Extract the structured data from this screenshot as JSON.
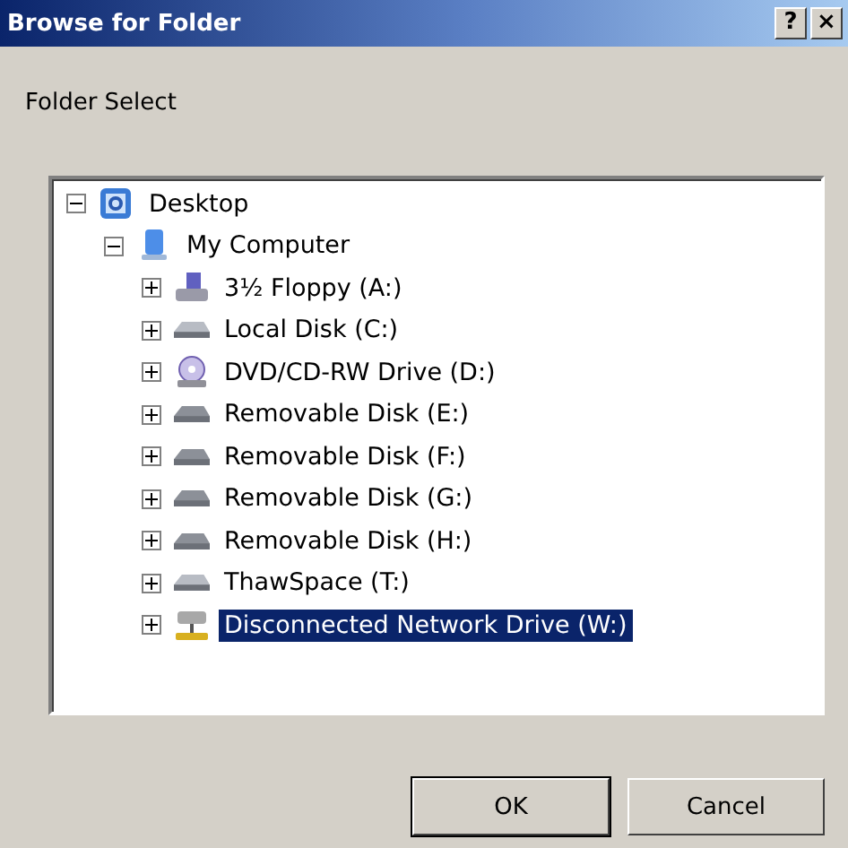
{
  "window": {
    "title": "Browse for Folder",
    "buttons": [
      "?",
      "×"
    ]
  },
  "prompt": "Folder Select",
  "tree": [
    {
      "label": "Desktop",
      "kind": "desktop",
      "expanded": true,
      "selected": false,
      "children": [
        {
          "label": "My Computer",
          "kind": "computer",
          "expanded": true,
          "selected": false,
          "children": [
            {
              "label": "3½ Floppy (A:)",
              "kind": "floppy",
              "expanded": false,
              "selected": false
            },
            {
              "label": "Local Disk (C:)",
              "kind": "disk",
              "expanded": false,
              "selected": false
            },
            {
              "label": "DVD/CD-RW Drive (D:)",
              "kind": "cd",
              "expanded": false,
              "selected": false
            },
            {
              "label": "Removable Disk (E:)",
              "kind": "removable",
              "expanded": false,
              "selected": false
            },
            {
              "label": "Removable Disk (F:)",
              "kind": "removable",
              "expanded": false,
              "selected": false
            },
            {
              "label": "Removable Disk (G:)",
              "kind": "removable",
              "expanded": false,
              "selected": false
            },
            {
              "label": "Removable Disk (H:)",
              "kind": "removable",
              "expanded": false,
              "selected": false
            },
            {
              "label": "ThawSpace (T:)",
              "kind": "disk",
              "expanded": false,
              "selected": false
            },
            {
              "label": "Disconnected Network Drive (W:)",
              "kind": "network",
              "expanded": false,
              "selected": true
            }
          ]
        }
      ]
    }
  ],
  "buttons": [
    {
      "label": "OK",
      "default": true
    },
    {
      "label": "Cancel",
      "default": false
    }
  ]
}
